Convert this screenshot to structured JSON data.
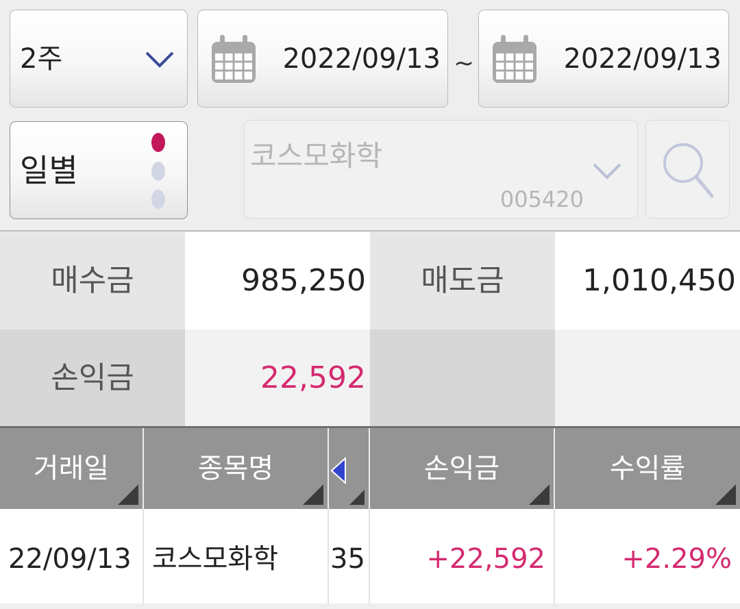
{
  "filter": {
    "period": "2주",
    "start_date": "2022/09/13",
    "separator": "~",
    "end_date": "2022/09/13",
    "unit": "일별",
    "stock_name": "코스모화학",
    "stock_code": "005420"
  },
  "summary": {
    "buy_label": "매수금",
    "buy_value": "985,250",
    "sell_label": "매도금",
    "sell_value": "1,010,450",
    "pnl_label": "손익금",
    "pnl_value": "22,592"
  },
  "grid": {
    "headers": [
      "거래일",
      "종목명",
      "",
      "손익금",
      "수익률"
    ],
    "rows": [
      {
        "date": "22/09/13",
        "name": "코스모화학",
        "qty": "35",
        "pnl": "+22,592",
        "rate": "+2.29%"
      }
    ]
  },
  "colors": {
    "positive": "#d42a6f",
    "accent": "#3a4a9a",
    "selected_dot": "#c2185b"
  },
  "icons": [
    "chevron-down-icon",
    "calendar-icon",
    "search-icon",
    "triangle-left-icon",
    "sort-corner-icon"
  ]
}
